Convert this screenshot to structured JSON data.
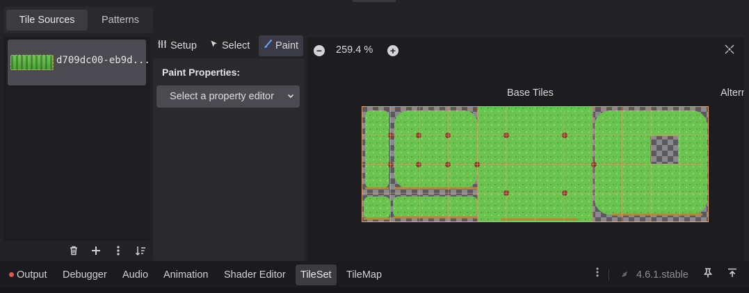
{
  "source_tabs": [
    "Tile Sources",
    "Patterns"
  ],
  "source_item": {
    "name": "d709dc00-eb9d..."
  },
  "source_toolbar": [
    "trash-icon",
    "plus-icon",
    "kebab-icon",
    "sort-icon"
  ],
  "modes": [
    {
      "label": "Setup",
      "icon": "wrench-icon"
    },
    {
      "label": "Select",
      "icon": "pointer-icon"
    },
    {
      "label": "Paint",
      "icon": "brush-icon",
      "active": true
    }
  ],
  "paint": {
    "title": "Paint Properties:",
    "select_label": "Select a property editor"
  },
  "atlas": {
    "zoom_out": "−",
    "zoom_in": "+",
    "zoom": "259.4 %",
    "base_label": "Base Tiles",
    "alt_label": "Altern"
  },
  "bottom_tabs": [
    {
      "label": "Output",
      "status": "error-dot"
    },
    {
      "label": "Debugger"
    },
    {
      "label": "Audio"
    },
    {
      "label": "Animation"
    },
    {
      "label": "Shader Editor"
    },
    {
      "label": "TileSet",
      "active": true
    },
    {
      "label": "TileMap"
    }
  ],
  "version": "4.6.1.stable",
  "colors": {
    "accent": "#6aa6ff",
    "grass": "#73c755",
    "grid": "#e8a070",
    "error": "#e0564e"
  }
}
